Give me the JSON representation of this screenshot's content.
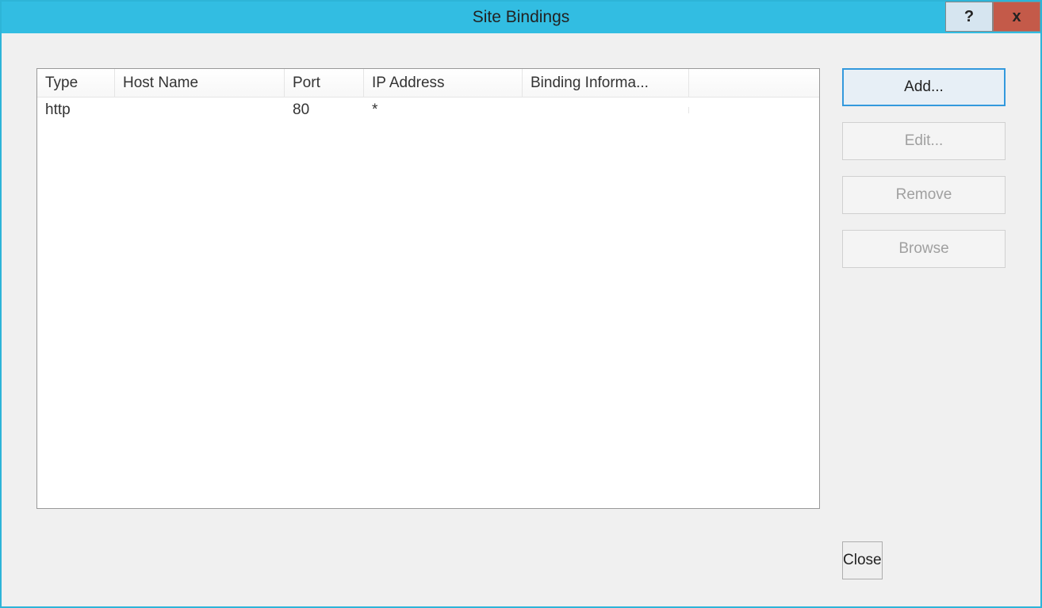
{
  "titlebar": {
    "title": "Site Bindings",
    "help": "?",
    "close": "x"
  },
  "table": {
    "headers": {
      "type": "Type",
      "host": "Host Name",
      "port": "Port",
      "ip": "IP Address",
      "info": "Binding Informa..."
    },
    "rows": [
      {
        "type": "http",
        "host": "",
        "port": "80",
        "ip": "*",
        "info": ""
      }
    ]
  },
  "buttons": {
    "add": "Add...",
    "edit": "Edit...",
    "remove": "Remove",
    "browse": "Browse",
    "close": "Close"
  }
}
